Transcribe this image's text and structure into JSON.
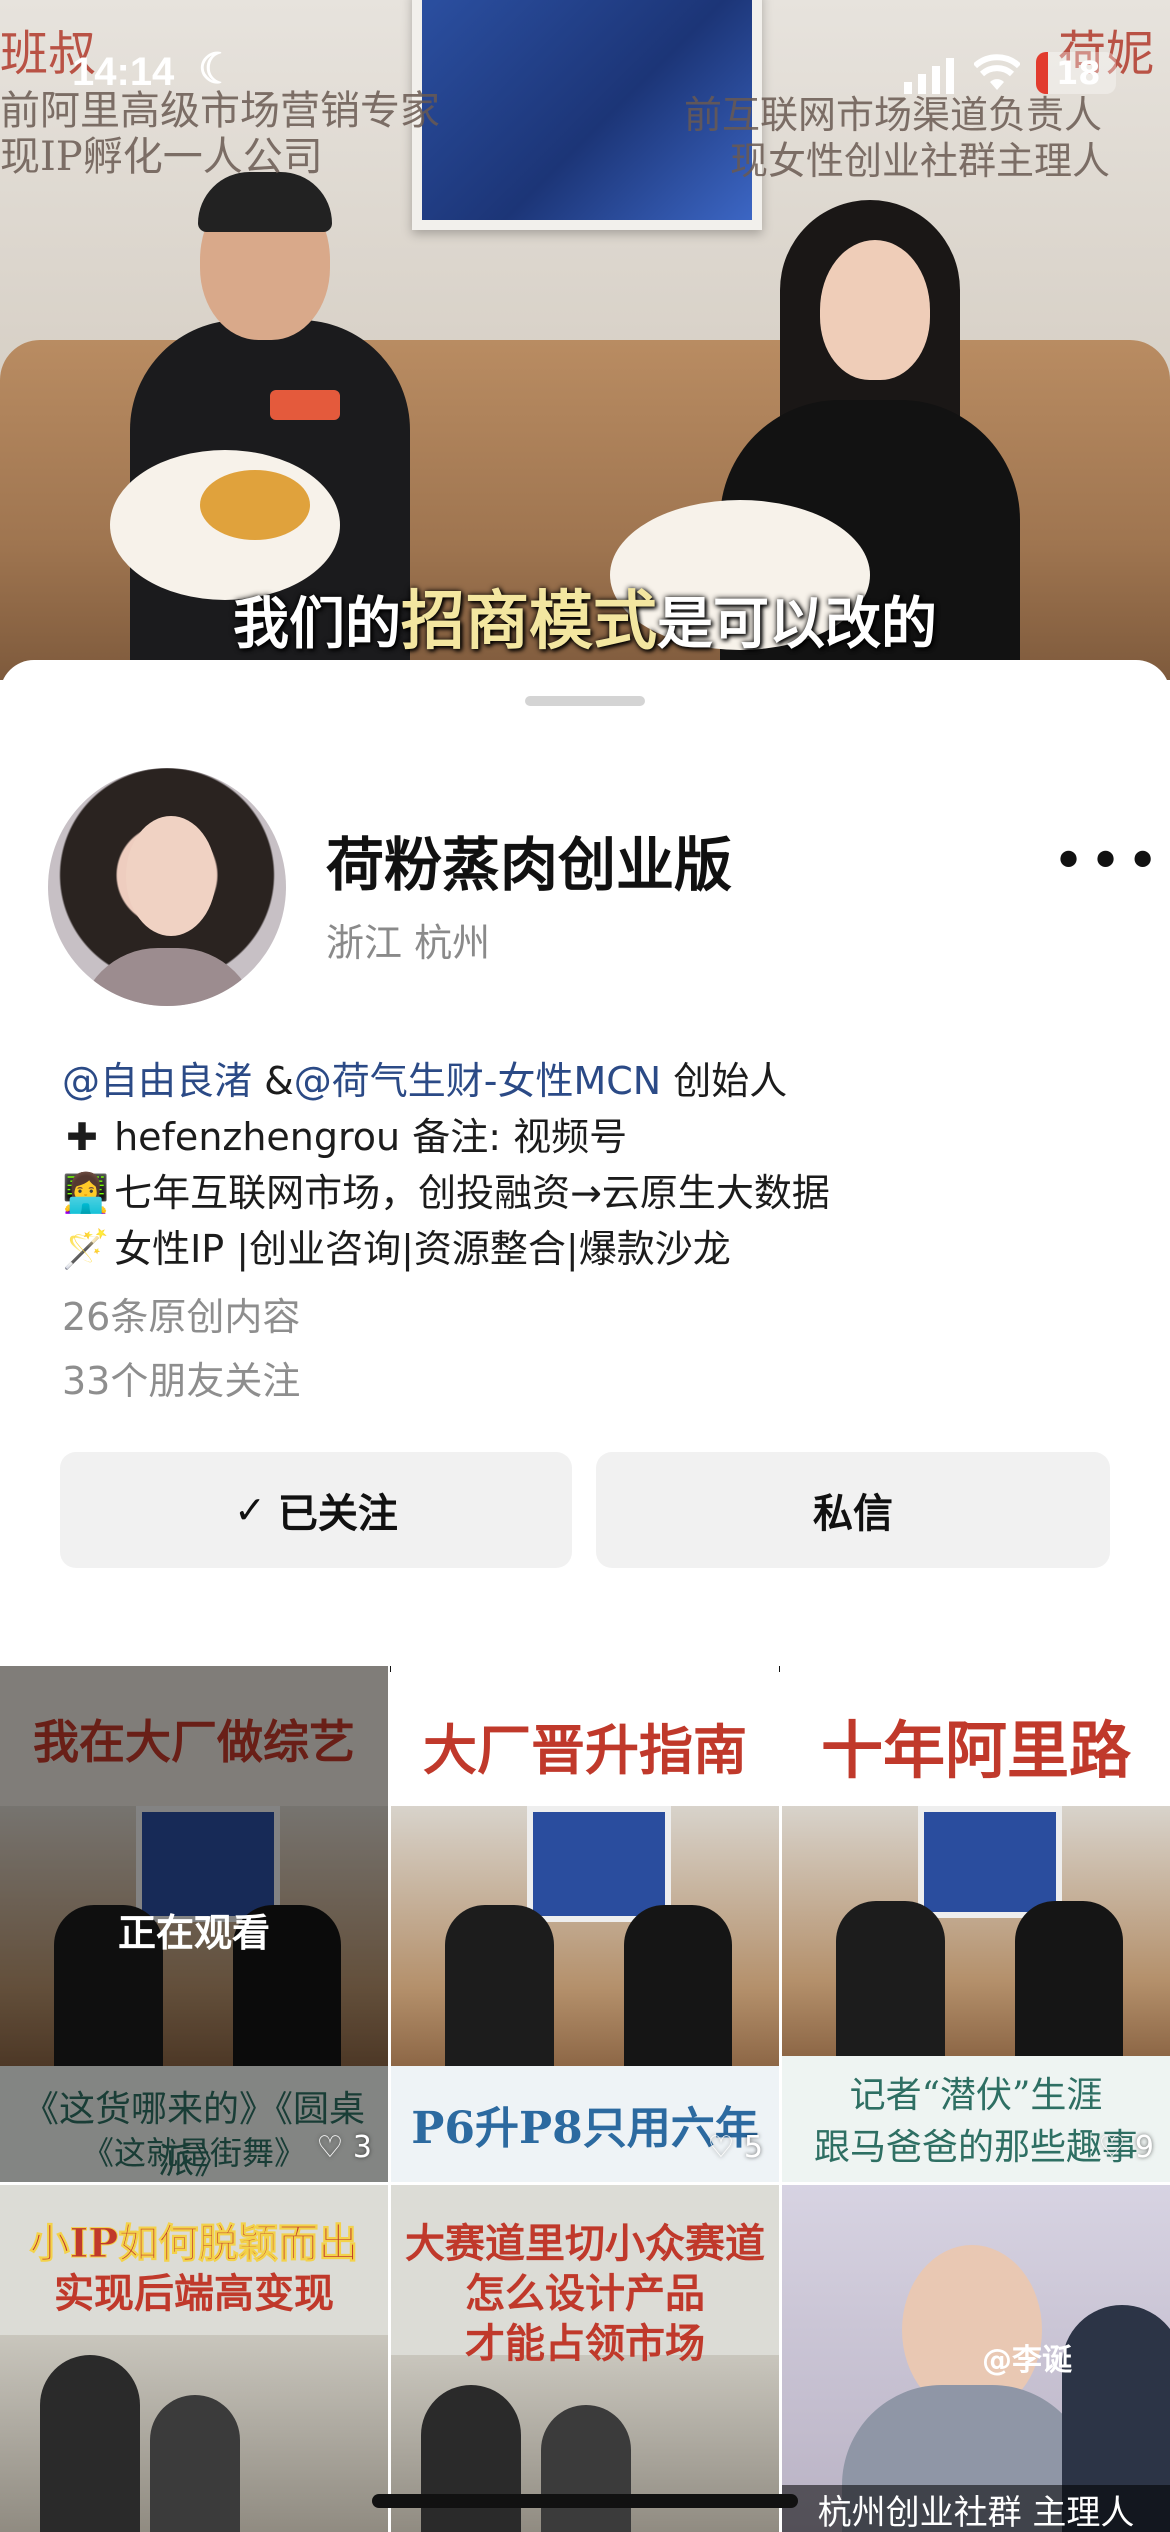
{
  "status_bar": {
    "time": "14:14",
    "battery": "18"
  },
  "video": {
    "left_tag": "班叔",
    "left_desc1": "前阿里高级市场营销专家",
    "left_desc2": "现IP孵化一人公司",
    "right_tag": "荷妮",
    "right_desc1": "前互联网市场渠道负责人",
    "right_desc2": "现女性创业社群主理人",
    "subtitle_pre": "我们的",
    "subtitle_highlight": "招商模式",
    "subtitle_post": "是可以改的"
  },
  "profile": {
    "name": "荷粉蒸肉创业版",
    "location": "浙江 杭州",
    "more": "•••",
    "bio": {
      "line1_link1": "@自由良渚",
      "line1_sep": " &",
      "line1_link2": "@荷气生财-女性MCN",
      "line1_tail": "  创始人",
      "line2": "hefenzhengrou  备注: 视频号",
      "line3": "七年互联网市场，创投融资→云原生大数据",
      "line4": "女性IP |创业咨询|资源整合|爆款沙龙"
    },
    "original_count": "26条原创内容",
    "friends_following": "33个朋友关注"
  },
  "buttons": {
    "followed": "已关注",
    "message": "私信"
  },
  "grid": {
    "items": [
      {
        "banner": "我在大厂做综艺",
        "caption1": "《这货哪来的》《圆桌派》",
        "caption2": "《这就是街舞》",
        "likes": "3",
        "overlay": "正在观看"
      },
      {
        "banner": "大厂晋升指南",
        "caption1": "P6升P8只用六年",
        "likes": "5"
      },
      {
        "banner": "十年阿里路",
        "caption1": "记者“潜伏”生涯",
        "caption2": "跟马爸爸的那些趣事",
        "likes": "9"
      },
      {
        "banner": "小IP如何脱颖而出",
        "caption1": "实现后端高变现"
      },
      {
        "banner": "大赛道里切小众赛道",
        "caption1": "怎么设计产品",
        "caption2": "才能占领市场"
      },
      {
        "watermark": "@李诞",
        "caption1": "杭州创业社群 主理人"
      }
    ]
  },
  "colors": {
    "link": "#2b4a86",
    "button_bg": "#f1f1f1",
    "muted": "#8e8e8e"
  }
}
